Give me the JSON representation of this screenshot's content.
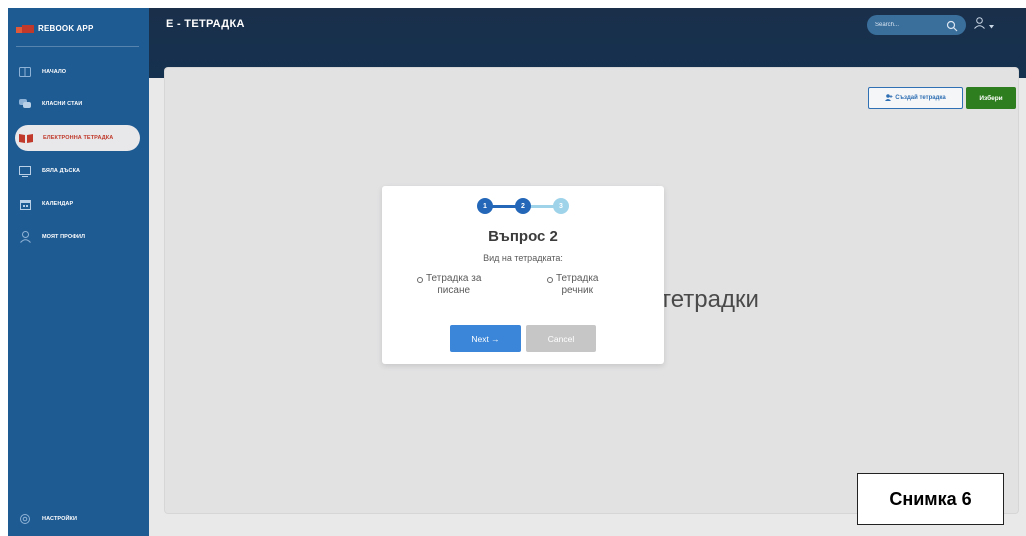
{
  "app": {
    "brand": "REBOOK APP",
    "page_title": "Е - ТЕТРАДКА"
  },
  "sidebar": {
    "items": [
      {
        "label": "НАЧАЛО",
        "icon": "book-open-icon"
      },
      {
        "label": "КЛАСНИ СТАИ",
        "icon": "chat-bubbles-icon"
      },
      {
        "label": "ЕЛЕКТРОННА ТЕТРАДКА",
        "icon": "notebook-icon",
        "active": true
      },
      {
        "label": "БЯЛА ДЪСКА",
        "icon": "whiteboard-icon"
      },
      {
        "label": "КАЛЕНДАР",
        "icon": "calendar-icon"
      },
      {
        "label": "МОЯТ ПРОФИЛ",
        "icon": "user-icon"
      }
    ],
    "settings_label": "НАСТРОЙКИ"
  },
  "header": {
    "search_placeholder": "Search..."
  },
  "toolbar": {
    "create_label": "Създай тетрадка",
    "choose_label": "Избери"
  },
  "background_text": "тетрадки",
  "modal": {
    "steps": [
      "1",
      "2",
      "3"
    ],
    "current_step": 2,
    "title": "Въпрос 2",
    "subtitle": "Вид на тетрадката:",
    "options": [
      {
        "line1": "Тетрадка за",
        "line2": "писане"
      },
      {
        "line1": "Тетрадка",
        "line2": "речник"
      }
    ],
    "next_label": "Next →",
    "cancel_label": "Cancel"
  },
  "caption": "Снимка 6",
  "colors": {
    "sidebar": "#1f5b93",
    "header": "#14314f",
    "accent_blue": "#3b86d8",
    "choose_green": "#2e7d1e",
    "active_red": "#c0392b",
    "step_done": "#2467b8",
    "step_pending": "#9fd3ea"
  }
}
